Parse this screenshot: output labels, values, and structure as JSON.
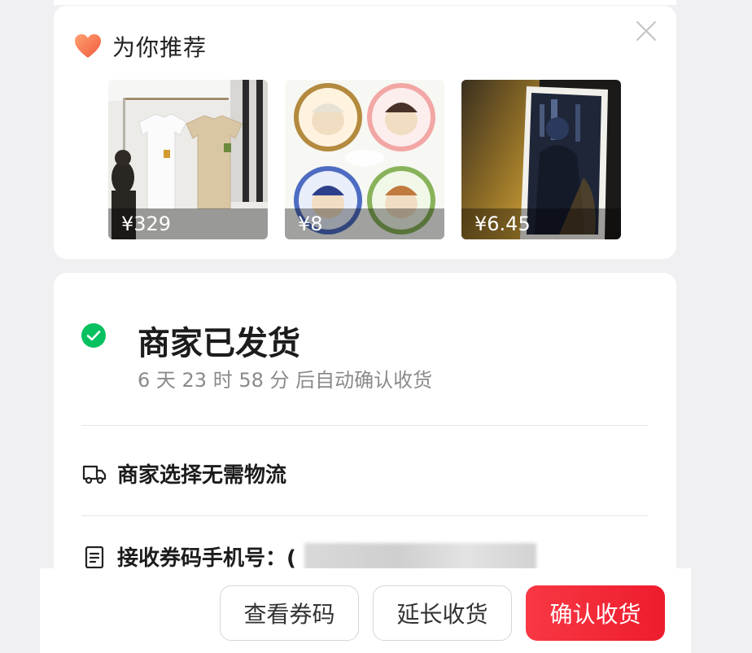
{
  "recommend": {
    "title": "为你推荐",
    "items": [
      {
        "price": "¥329",
        "image": "t-shirts-on-rack"
      },
      {
        "price": "¥8",
        "image": "anime-badges"
      },
      {
        "price": "¥6.45",
        "image": "photo-card"
      }
    ]
  },
  "order": {
    "status_title": "商家已发货",
    "status_sub": "6 天 23 时 58 分 后自动确认收货",
    "logistics": "商家选择无需物流",
    "phone_label": "接收券码手机号：("
  },
  "actions": {
    "view_code": "查看券码",
    "extend": "延长收货",
    "confirm": "确认收货"
  },
  "colors": {
    "accent": "#f02d3a",
    "success": "#07c160"
  }
}
